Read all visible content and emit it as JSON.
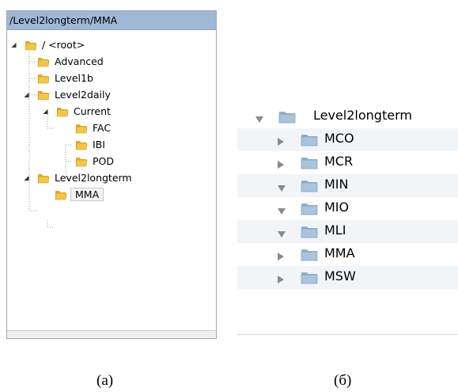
{
  "panel_a": {
    "path": "/Level2longterm/MMA",
    "nodes": [
      {
        "label": "/ <root>",
        "expanded": true
      },
      {
        "label": "Advanced"
      },
      {
        "label": "Level1b"
      },
      {
        "label": "Level2daily",
        "expanded": true
      },
      {
        "label": "Current",
        "expanded": true
      },
      {
        "label": "FAC"
      },
      {
        "label": "IBI"
      },
      {
        "label": "POD"
      },
      {
        "label": "Level2longterm",
        "expanded": true
      },
      {
        "label": "MMA",
        "selected": true
      }
    ],
    "icon": "folder-icon"
  },
  "panel_b": {
    "root": {
      "label": "Level2longterm",
      "expanded": true
    },
    "items": [
      {
        "label": "MCO",
        "expanded": false
      },
      {
        "label": "MCR",
        "expanded": false
      },
      {
        "label": "MIN",
        "expanded": true
      },
      {
        "label": "MIO",
        "expanded": true
      },
      {
        "label": "MLI",
        "expanded": true
      },
      {
        "label": "MMA",
        "expanded": false
      },
      {
        "label": "MSW",
        "expanded": false
      }
    ],
    "icon": "folder-icon"
  },
  "captions": {
    "a": "(a)",
    "b": "(б)"
  },
  "colors": {
    "path_bar": "#9fb8d6",
    "folder_yellow": "#f2c649",
    "mac_folder": "#a9c4dc",
    "stripe": "#f2f5f8"
  }
}
